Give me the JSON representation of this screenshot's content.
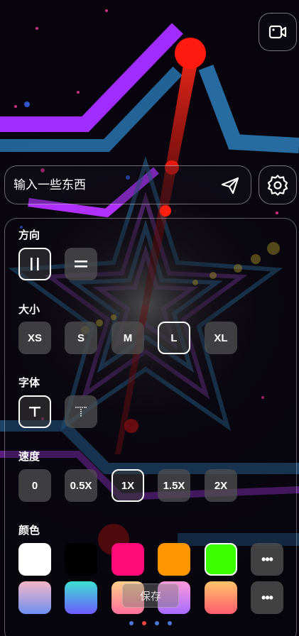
{
  "input": {
    "placeholder": "输入一些东西"
  },
  "icons": {
    "camera": "video-camera-icon",
    "send": "send-icon",
    "settings": "gear-icon"
  },
  "sections": {
    "direction": {
      "label": "方向",
      "options": [
        {
          "glyph": "||",
          "selected": true
        },
        {
          "glyph": "=",
          "selected": false
        }
      ]
    },
    "size": {
      "label": "大小",
      "options": [
        "XS",
        "S",
        "M",
        "L",
        "XL"
      ],
      "selected": "L"
    },
    "font": {
      "label": "字体",
      "options": [
        {
          "glyph": "T",
          "selected": true
        },
        {
          "glyph": "T-dotted",
          "selected": false
        }
      ]
    },
    "speed": {
      "label": "速度",
      "options": [
        "0",
        "0.5X",
        "1X",
        "1.5X",
        "2X"
      ],
      "selected": "1X"
    },
    "color": {
      "label": "颜色",
      "solid": [
        "#ffffff",
        "#000000",
        "#ff0a78",
        "#ff9500",
        "#3cff00"
      ],
      "solid_selected": "#3cff00",
      "gradients": [
        [
          "#f4b6c8",
          "#6f8ff0"
        ],
        [
          "#3de0d0",
          "#6b5cff"
        ],
        [
          "#ffd08a",
          "#ff6f9c"
        ],
        [
          "#ff9ad9",
          "#a66cff"
        ],
        [
          "#ffc46a",
          "#ff5c6e"
        ]
      ],
      "more_label": "•••"
    }
  },
  "save_label": "保存",
  "pager": {
    "count": 4,
    "active": 1,
    "colors": {
      "active": "#e8453c",
      "inactive": "#4a78d8"
    }
  }
}
